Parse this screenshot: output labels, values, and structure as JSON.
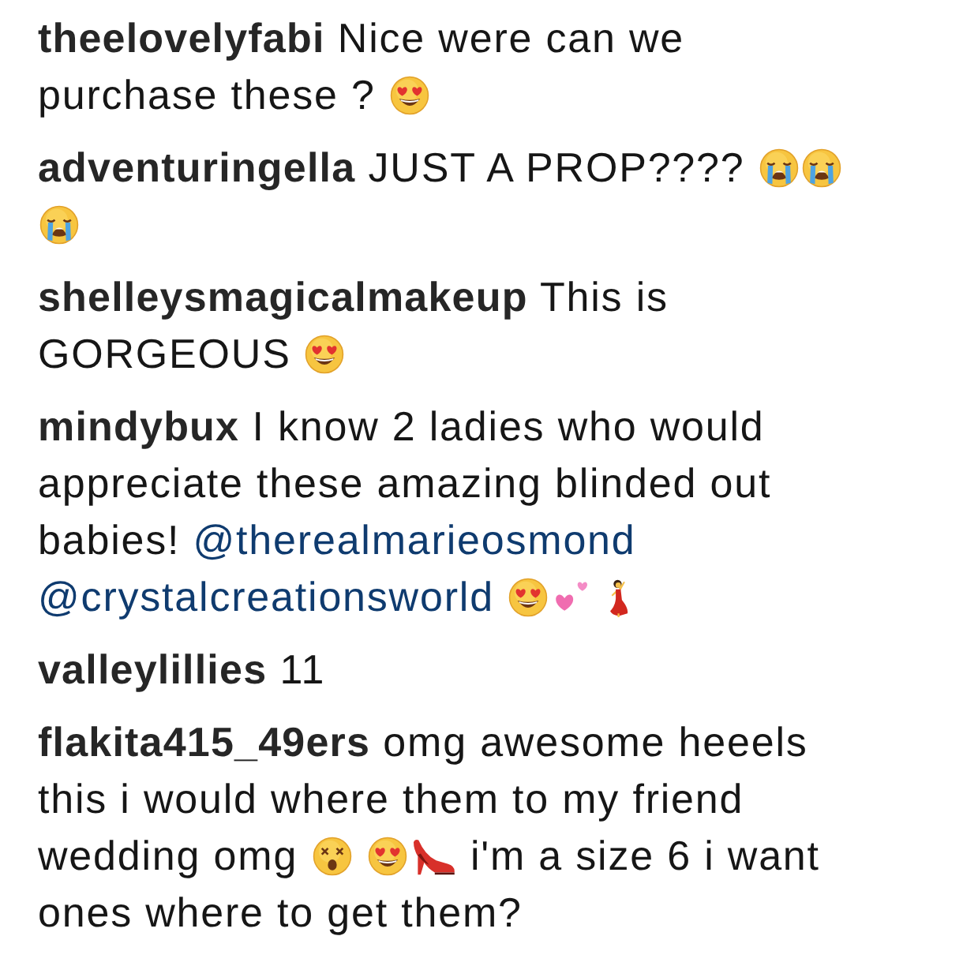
{
  "comments": [
    {
      "username": "theelovelyfabi",
      "parts": [
        {
          "kind": "text",
          "text": "Nice were can we purchase these ?"
        },
        {
          "kind": "emoji",
          "icons": [
            {
              "kind": "hearteyes"
            }
          ]
        }
      ]
    },
    {
      "username": "adventuringella",
      "parts": [
        {
          "kind": "text",
          "text": "JUST A PROP????"
        },
        {
          "kind": "emoji",
          "icons": [
            {
              "kind": "crying"
            },
            {
              "kind": "crying"
            },
            {
              "kind": "crying"
            }
          ]
        }
      ]
    },
    {
      "username": "shelleysmagicalmakeup",
      "parts": [
        {
          "kind": "text",
          "text": "This is GORGEOUS"
        },
        {
          "kind": "emoji",
          "icons": [
            {
              "kind": "hearteyes"
            }
          ]
        }
      ]
    },
    {
      "username": "mindybux",
      "parts": [
        {
          "kind": "text",
          "text": "I know 2 ladies who would appreciate these amazing blinded out babies!"
        },
        {
          "kind": "mention",
          "text": "@therealmarieosmond"
        },
        {
          "kind": "mention",
          "text": "@crystalcreationsworld"
        },
        {
          "kind": "emoji",
          "icons": [
            {
              "kind": "hearteyes"
            },
            {
              "kind": "twohearts"
            }
          ]
        },
        {
          "kind": "emoji",
          "icons": [
            {
              "kind": "dancer"
            }
          ]
        }
      ]
    },
    {
      "username": "valleylillies",
      "parts": [
        {
          "kind": "text",
          "text": "11"
        }
      ]
    },
    {
      "username": "flakita415_49ers",
      "parts": [
        {
          "kind": "text",
          "text": "omg awesome heeels this i would where them to my friend wedding omg"
        },
        {
          "kind": "emoji",
          "icons": [
            {
              "kind": "dizzy"
            }
          ]
        },
        {
          "kind": "emoji",
          "icons": [
            {
              "kind": "hearteyes"
            },
            {
              "kind": "heel"
            }
          ]
        },
        {
          "kind": "text",
          "text": "i'm a size 6 i want ones where to get them?"
        }
      ]
    }
  ]
}
